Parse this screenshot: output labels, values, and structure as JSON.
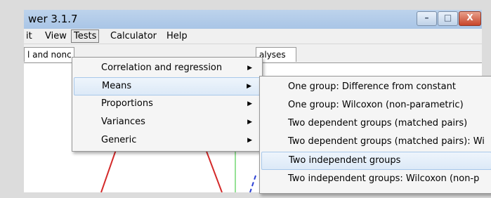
{
  "window": {
    "title": "wer 3.1.7",
    "minimize_glyph": "–",
    "maximize_glyph": "□",
    "close_glyph": "X"
  },
  "menubar": {
    "items": [
      "it",
      "View",
      "Tests",
      "Calculator",
      "Help"
    ],
    "active": "Tests"
  },
  "tabs": {
    "left": "l and nonc",
    "right": "alyses"
  },
  "tests_menu": {
    "items": [
      "Correlation and regression",
      "Means",
      "Proportions",
      "Variances",
      "Generic"
    ],
    "highlighted": "Means",
    "arrow_glyph": "▶"
  },
  "means_submenu": {
    "items": [
      "One group: Difference from constant",
      "One group: Wilcoxon (non-parametric)",
      "Two dependent groups (matched pairs)",
      "Two dependent groups (matched pairs): Wi",
      "Two independent groups",
      "Two independent groups: Wilcoxon (non-p"
    ],
    "highlighted": "Two independent groups"
  },
  "colors": {
    "titlebar": "#b5cde9",
    "menu_bg": "#f5f5f5",
    "highlight": "#dce9f7",
    "plot_red": "#d42a2a",
    "plot_green": "#2ec42e",
    "plot_blue": "#2a3fd4"
  }
}
